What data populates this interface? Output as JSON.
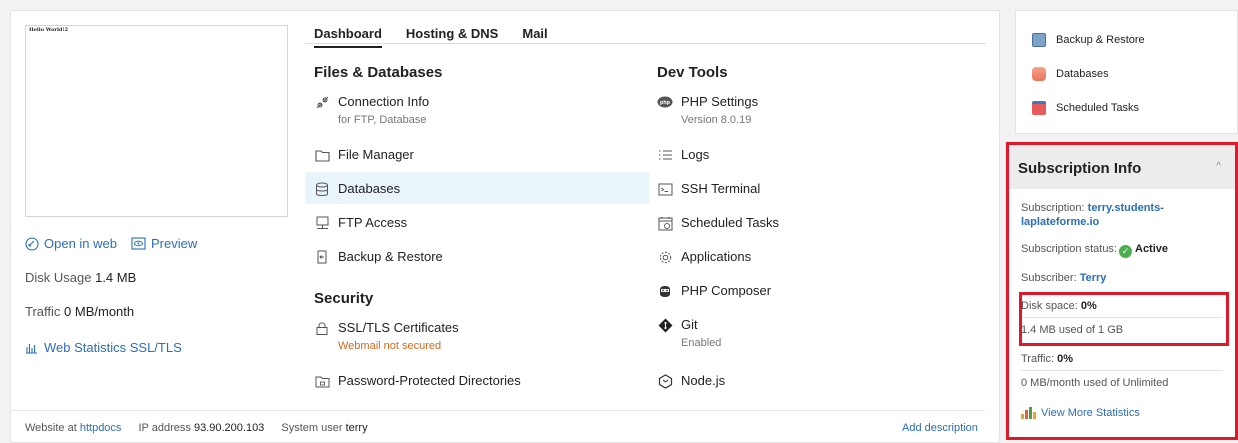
{
  "preview": {
    "hello_text": "Hello World!2"
  },
  "site_links": {
    "open_in_web": "Open in web",
    "preview": "Preview"
  },
  "stats": {
    "disk_label": "Disk Usage",
    "disk_value": "1.4 MB",
    "traffic_label": "Traffic",
    "traffic_value": "0 MB/month",
    "web_stats": "Web Statistics SSL/TLS"
  },
  "tabs": [
    {
      "label": "Dashboard",
      "active": true
    },
    {
      "label": "Hosting & DNS",
      "active": false
    },
    {
      "label": "Mail",
      "active": false
    }
  ],
  "files_db": {
    "title": "Files & Databases",
    "connection_info": {
      "label": "Connection Info",
      "sub": "for FTP, Database"
    },
    "file_manager": "File Manager",
    "databases": "Databases",
    "ftp_access": "FTP Access",
    "backup_restore": "Backup & Restore"
  },
  "security": {
    "title": "Security",
    "ssl": {
      "label": "SSL/TLS Certificates",
      "sub": "Webmail not secured"
    },
    "password_dirs": "Password-Protected Directories"
  },
  "dev_tools": {
    "title": "Dev Tools",
    "php_settings": {
      "label": "PHP Settings",
      "sub": "Version 8.0.19"
    },
    "logs": "Logs",
    "ssh_terminal": "SSH Terminal",
    "scheduled_tasks": "Scheduled Tasks",
    "applications": "Applications",
    "php_composer": "PHP Composer",
    "git": {
      "label": "Git",
      "sub": "Enabled"
    },
    "nodejs": "Node.js"
  },
  "footer": {
    "website_at": "Website at",
    "httpdocs": "httpdocs",
    "ip_label": "IP address",
    "ip_value": "93.90.200.103",
    "user_label": "System user",
    "user_value": "terry",
    "add_description": "Add description"
  },
  "right_card": {
    "backup_restore": "Backup & Restore",
    "databases": "Databases",
    "scheduled_tasks": "Scheduled Tasks"
  },
  "subscription": {
    "title": "Subscription Info",
    "sub_label": "Subscription:",
    "sub_value_1": "terry.students-",
    "sub_value_2": "laplateforme.io",
    "status_label": "Subscription status:",
    "status_value": "Active",
    "subscriber_label": "Subscriber:",
    "subscriber_value": "Terry",
    "disk_label": "Disk space:",
    "disk_value": "0%",
    "disk_used": "1.4 MB used of 1 GB",
    "traffic_label": "Traffic:",
    "traffic_value": "0%",
    "traffic_used": "0 MB/month used of Unlimited",
    "view_more": "View More Statistics"
  }
}
